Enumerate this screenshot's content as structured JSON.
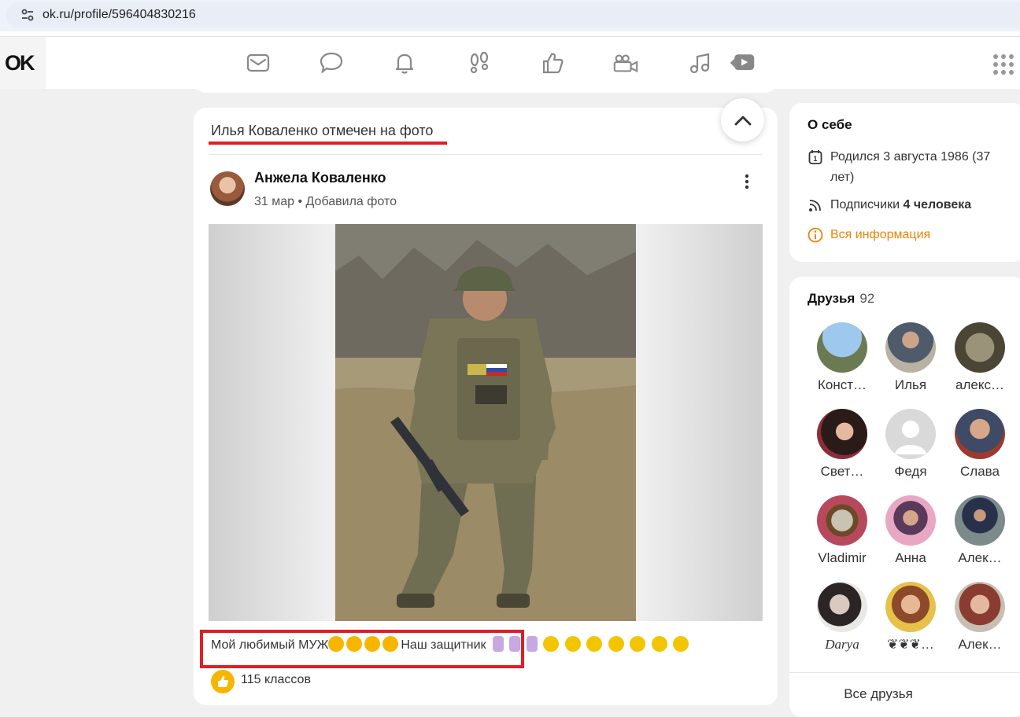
{
  "browser": {
    "url": "ok.ru/profile/596404830216"
  },
  "topnav": {
    "logo": "OK",
    "icons": [
      "mail-icon",
      "chat-icon",
      "bell-icon",
      "footprints-icon",
      "like-icon",
      "video-camera-icon",
      "music-icon",
      "video-play-icon"
    ]
  },
  "post": {
    "header": "Илья Коваленко отмечен на фото",
    "author": "Анжела Коваленко",
    "meta": "31 мар • Добавила фото",
    "caption": "Мой любимый МУЖ",
    "caption_tail": "Наш защитник",
    "likes": "115 классов"
  },
  "about": {
    "title": "О себе",
    "birth": "Родился 3 августа 1986 (37 лет)",
    "subscribers_prefix": "Подписчики",
    "subscribers_count": "4 человека",
    "all_info": "Вся информация"
  },
  "friends": {
    "title": "Друзья",
    "count": "92",
    "items": [
      {
        "name": "Конст…"
      },
      {
        "name": "Илья"
      },
      {
        "name": "алекс…"
      },
      {
        "name": "Свет…"
      },
      {
        "name": "Федя"
      },
      {
        "name": "Слава"
      },
      {
        "name": "Vladimir"
      },
      {
        "name": "Анна"
      },
      {
        "name": "Алек…"
      },
      {
        "name": "Darya"
      },
      {
        "name": "❦❦❦…"
      },
      {
        "name": "Алек…"
      }
    ],
    "all_label": "Все друзья"
  },
  "colors": {
    "accent": "#ee8208",
    "highlight": "#e01e25",
    "like": "#f7b500"
  }
}
